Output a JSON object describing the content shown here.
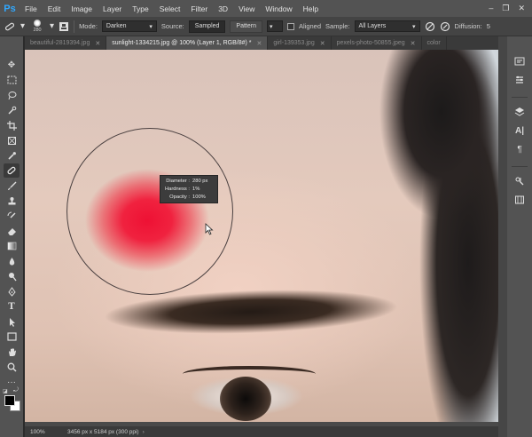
{
  "app": {
    "logo": "Ps"
  },
  "menu": [
    "File",
    "Edit",
    "Image",
    "Layer",
    "Type",
    "Select",
    "Filter",
    "3D",
    "View",
    "Window",
    "Help"
  ],
  "window_controls": [
    "–",
    "❐",
    "✕"
  ],
  "options": {
    "brush_size": "280",
    "mode_label": "Mode:",
    "mode_value": "Darken",
    "source_label": "Source:",
    "source_sampled": "Sampled",
    "source_pattern": "Pattern",
    "aligned_label": "Aligned",
    "sample_label": "Sample:",
    "sample_value": "All Layers",
    "diffusion_label": "Diffusion:",
    "diffusion_value": "5"
  },
  "tabs": [
    {
      "label": "beautiful-2819394.jpg",
      "active": false
    },
    {
      "label": "sunlight-1334215.jpg @ 100% (Layer 1, RGB/8#) *",
      "active": true
    },
    {
      "label": "girl-139353.jpg",
      "active": false
    },
    {
      "label": "pexels-photo-50855.jpeg",
      "active": false
    },
    {
      "label": "color",
      "active": false
    }
  ],
  "brush_hud": {
    "diameter_label": "Diameter :",
    "diameter_value": "280 px",
    "hardness_label": "Hardness :",
    "hardness_value": "1%",
    "opacity_label": "Opacity :",
    "opacity_value": "100%"
  },
  "status": {
    "zoom": "100%",
    "doc_info": "3456 px x 5184 px (300 ppi)"
  },
  "colors": {
    "foreground": "#000000",
    "background": "#ffffff",
    "accent": "#31a8ff"
  }
}
